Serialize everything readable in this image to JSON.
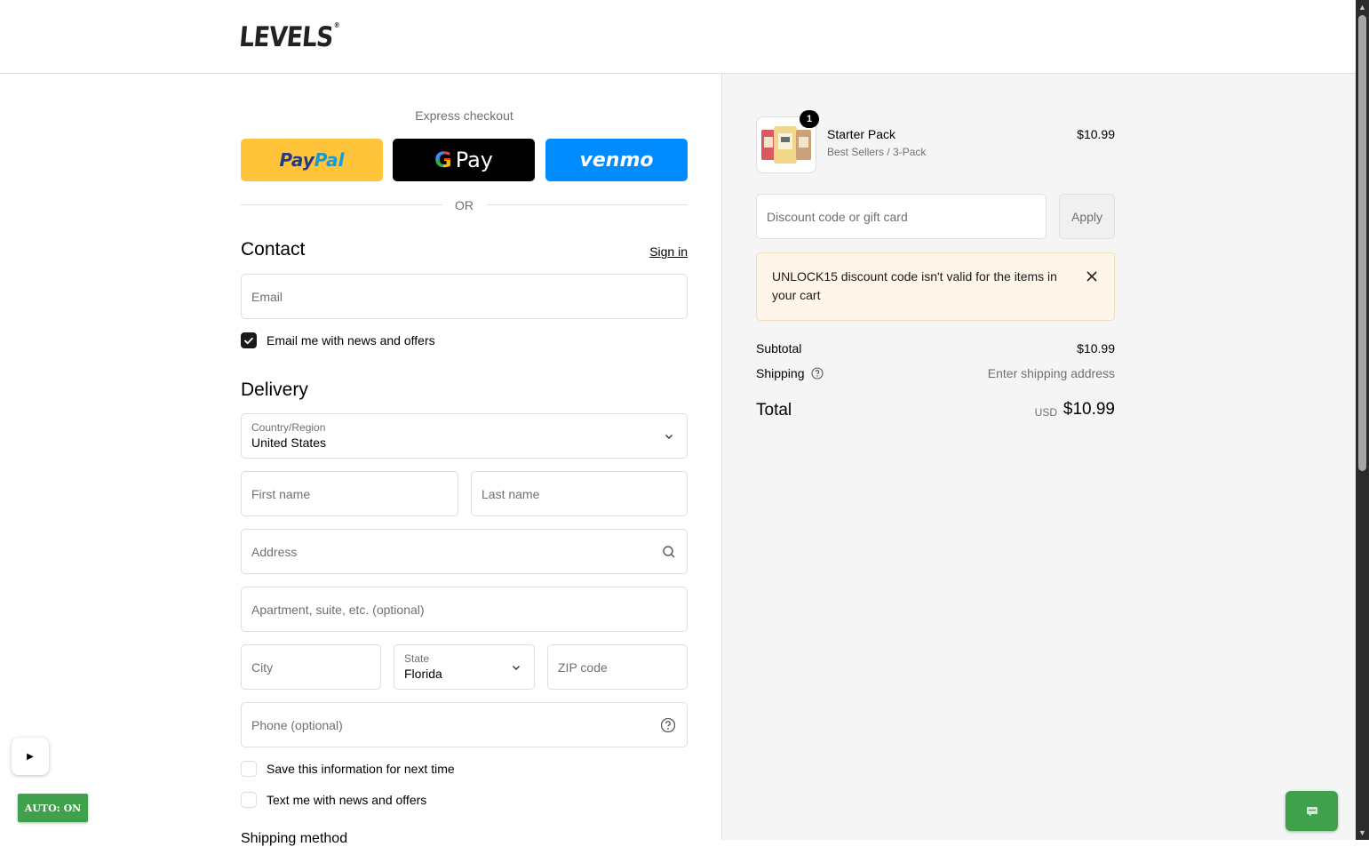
{
  "brand": {
    "logo_text": "LEVELS",
    "logo_mark": "®"
  },
  "express": {
    "label": "Express checkout",
    "paypal_p1": "Pay",
    "paypal_p2": "Pal",
    "gpay_g": "G",
    "gpay_text": "Pay",
    "venmo_text": "venmo",
    "or_text": "OR"
  },
  "contact": {
    "heading": "Contact",
    "sign_in": "Sign in",
    "email_placeholder": "Email",
    "news_checkbox_label": "Email me with news and offers",
    "news_checked": true
  },
  "delivery": {
    "heading": "Delivery",
    "country_label": "Country/Region",
    "country_value": "United States",
    "first_name_placeholder": "First name",
    "last_name_placeholder": "Last name",
    "address_placeholder": "Address",
    "apartment_placeholder": "Apartment, suite, etc. (optional)",
    "city_placeholder": "City",
    "state_label": "State",
    "state_value": "Florida",
    "zip_placeholder": "ZIP code",
    "phone_placeholder": "Phone (optional)",
    "save_info_label": "Save this information for next time",
    "text_news_label": "Text me with news and offers",
    "shipping_method_heading": "Shipping method"
  },
  "cart": {
    "quantity": "1",
    "product_title": "Starter Pack",
    "product_variant": "Best Sellers / 3-Pack",
    "product_price": "$10.99",
    "discount_placeholder": "Discount code or gift card",
    "apply_label": "Apply",
    "notice_text": "UNLOCK15 discount code isn't valid for the items in your cart",
    "subtotal_label": "Subtotal",
    "subtotal_value": "$10.99",
    "shipping_label": "Shipping",
    "shipping_value": "Enter shipping address",
    "total_label": "Total",
    "total_currency": "USD",
    "total_value": "$10.99"
  },
  "overlay": {
    "play_glyph": "▶",
    "auto_label": "AUTO: ON"
  },
  "colors": {
    "paypal": "#ffc439",
    "gpay": "#000000",
    "venmo": "#008cff",
    "notice_bg": "#fff6e9",
    "accent_green": "#3fa14b"
  }
}
